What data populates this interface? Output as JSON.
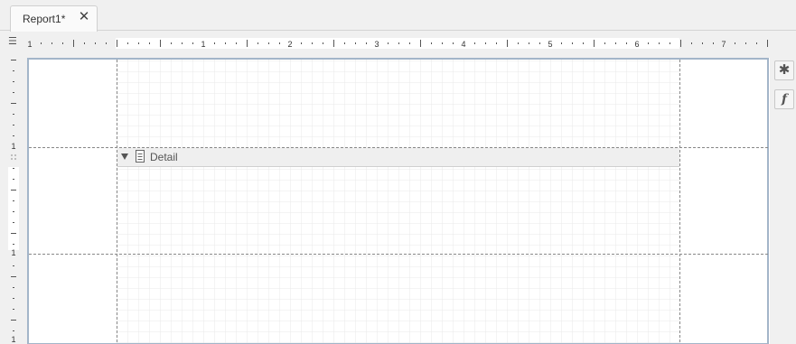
{
  "tabs": [
    {
      "title": "Report1*",
      "close_glyph": "✕",
      "active": true
    }
  ],
  "ruler": {
    "menu_glyph": "☰",
    "horizontal_labels": [
      "1",
      "1",
      "2",
      "3",
      "4",
      "5",
      "6",
      "7"
    ],
    "vertical_labels": [
      "1",
      "1",
      "1"
    ]
  },
  "design_surface": {
    "bands": [
      {
        "name": "Detail",
        "expanded": true,
        "icon": "document-icon"
      }
    ]
  },
  "side_toolbar": {
    "buttons": [
      {
        "name": "properties",
        "glyph": "✱",
        "icon": "gear-icon"
      },
      {
        "name": "expressions",
        "glyph": "f",
        "icon": "function-icon"
      }
    ]
  },
  "colors": {
    "accent_border": "#a3b5c9",
    "grid_line": "#e8e8e8",
    "margin_line": "#888888",
    "band_header": "#efefef"
  }
}
